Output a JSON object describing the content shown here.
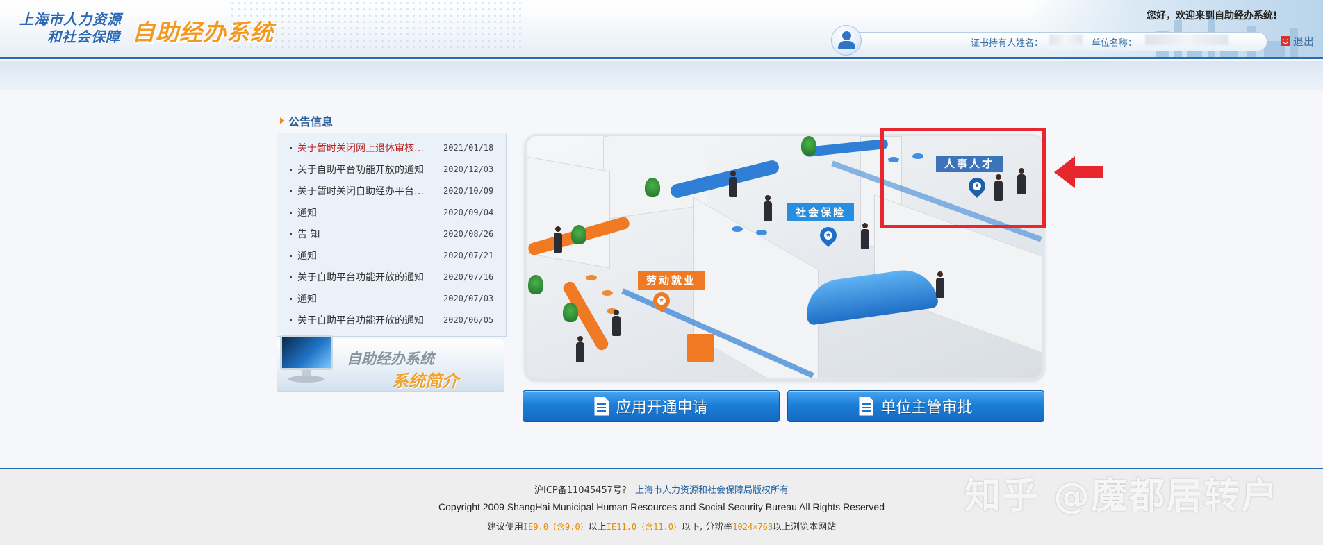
{
  "header": {
    "logo_line1": "上海市人力资源",
    "logo_line2": "和社会保障",
    "logo_system": "自助经办系统",
    "welcome": "您好，欢迎来到自助经办系统!",
    "holder_label": "证书持有人姓名：",
    "holder_value": "",
    "unit_label": "单位名称：",
    "unit_value": "",
    "logout_label": "退出",
    "logout_icon": "logout-icon"
  },
  "notices": {
    "title": "公告信息",
    "items": [
      {
        "title": "关于暂时关闭网上退休审核…",
        "date": "2021/01/18",
        "highlight": true
      },
      {
        "title": "关于自助平台功能开放的通知",
        "date": "2020/12/03",
        "highlight": false
      },
      {
        "title": "关于暂时关闭自助经办平台…",
        "date": "2020/10/09",
        "highlight": false
      },
      {
        "title": "通知",
        "date": "2020/09/04",
        "highlight": false
      },
      {
        "title": "告 知",
        "date": "2020/08/26",
        "highlight": false
      },
      {
        "title": "通知",
        "date": "2020/07/21",
        "highlight": false
      },
      {
        "title": "关于自助平台功能开放的通知",
        "date": "2020/07/16",
        "highlight": false
      },
      {
        "title": "通知",
        "date": "2020/07/03",
        "highlight": false
      },
      {
        "title": "关于自助平台功能开放的通知",
        "date": "2020/06/05",
        "highlight": false
      }
    ]
  },
  "intro_banner": {
    "line1": "自助经办系统",
    "line2": "系统简介"
  },
  "scene": {
    "zones": {
      "labor": "劳动就业",
      "social": "社会保险",
      "talent": "人事人才"
    },
    "colors": {
      "labor": "#f07a24",
      "social": "#2a8ee0",
      "talent": "#3d73b8",
      "highlight": "#e8262d"
    }
  },
  "actions": {
    "apply_label": "应用开通申请",
    "approve_label": "单位主管审批"
  },
  "footer": {
    "icp": "沪ICP备11045457号?",
    "owner": "上海市人力资源和社会保障局版权所有",
    "copyright": "Copyright 2009 ShangHai Municipal Human Resources and Social Security Bureau All Rights Reserved",
    "rec_prefix": "建议使用",
    "rec_ie9": "IE9.0（含9.0）",
    "rec_mid": "以上",
    "rec_ie11": "IE11.0（含11.0）",
    "rec_mid2": "以下, 分辨率",
    "rec_res": "1024×768",
    "rec_suffix": "以上浏览本网站"
  },
  "watermark": "知乎 @魔都居转户"
}
